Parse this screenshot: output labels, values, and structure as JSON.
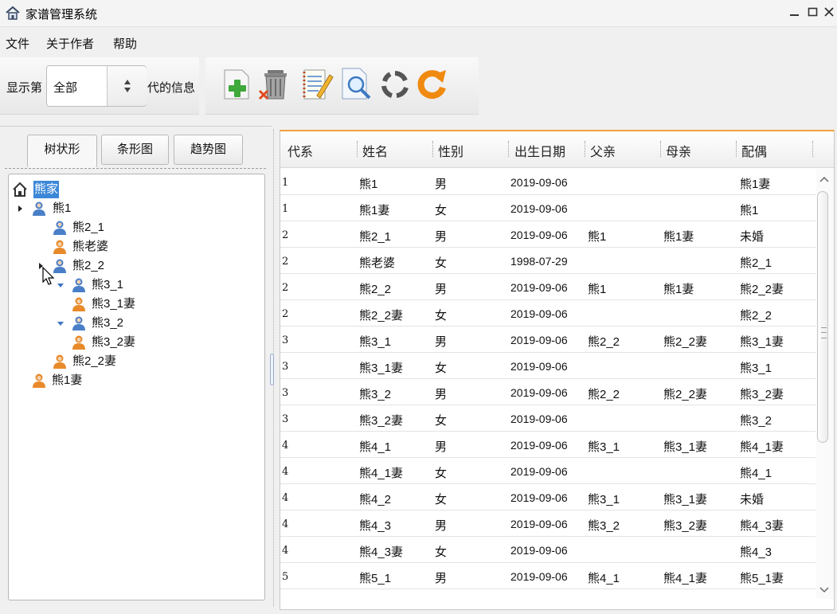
{
  "window": {
    "title": "家谱管理系统"
  },
  "menu": {
    "items": [
      "文件",
      "关于作者",
      "帮助"
    ]
  },
  "toolbar": {
    "show_prefix": "显示第",
    "show_suffix": "代的信息",
    "generation_select": {
      "value": "全部"
    },
    "tools": [
      "add-icon",
      "delete-icon",
      "edit-icon",
      "search-icon",
      "refresh-icon",
      "reload-icon"
    ]
  },
  "left_panel": {
    "tabs": [
      {
        "label": "树状形",
        "active": true
      },
      {
        "label": "条形图",
        "active": false
      },
      {
        "label": "趋势图",
        "active": false
      }
    ],
    "tree": [
      {
        "label": "熊家",
        "icon": "home-icon",
        "selected": true
      },
      {
        "label": "熊1",
        "icon": "male-person-icon",
        "toggle": "collapsed"
      },
      {
        "label": "熊2_1",
        "icon": "male-person-icon"
      },
      {
        "label": "熊老婆",
        "icon": "female-person-icon"
      },
      {
        "label": "熊2_2",
        "icon": "male-person-icon",
        "toggle": "collapsed"
      },
      {
        "label": "熊3_1",
        "icon": "male-person-icon",
        "toggle": "expanded"
      },
      {
        "label": "熊3_1妻",
        "icon": "female-person-icon"
      },
      {
        "label": "熊3_2",
        "icon": "male-person-icon",
        "toggle": "expanded"
      },
      {
        "label": "熊3_2妻",
        "icon": "female-person-icon"
      },
      {
        "label": "熊2_2妻",
        "icon": "female-person-icon"
      },
      {
        "label": "熊1妻",
        "icon": "female-person-icon"
      }
    ]
  },
  "table": {
    "columns": [
      "代系",
      "姓名",
      "性别",
      "出生日期",
      "父亲",
      "母亲",
      "配偶"
    ],
    "rows": [
      [
        "1",
        "熊1",
        "男",
        "2019-09-06",
        "",
        "",
        "熊1妻"
      ],
      [
        "1",
        "熊1妻",
        "女",
        "2019-09-06",
        "",
        "",
        "熊1"
      ],
      [
        "2",
        "熊2_1",
        "男",
        "2019-09-06",
        "熊1",
        "熊1妻",
        "未婚"
      ],
      [
        "2",
        "熊老婆",
        "女",
        "1998-07-29",
        "",
        "",
        "熊2_1"
      ],
      [
        "2",
        "熊2_2",
        "男",
        "2019-09-06",
        "熊1",
        "熊1妻",
        "熊2_2妻"
      ],
      [
        "2",
        "熊2_2妻",
        "女",
        "2019-09-06",
        "",
        "",
        "熊2_2"
      ],
      [
        "3",
        "熊3_1",
        "男",
        "2019-09-06",
        "熊2_2",
        "熊2_2妻",
        "熊3_1妻"
      ],
      [
        "3",
        "熊3_1妻",
        "女",
        "2019-09-06",
        "",
        "",
        "熊3_1"
      ],
      [
        "3",
        "熊3_2",
        "男",
        "2019-09-06",
        "熊2_2",
        "熊2_2妻",
        "熊3_2妻"
      ],
      [
        "3",
        "熊3_2妻",
        "女",
        "2019-09-06",
        "",
        "",
        "熊3_2"
      ],
      [
        "4",
        "熊4_1",
        "男",
        "2019-09-06",
        "熊3_1",
        "熊3_1妻",
        "熊4_1妻"
      ],
      [
        "4",
        "熊4_1妻",
        "女",
        "2019-09-06",
        "",
        "",
        "熊4_1"
      ],
      [
        "4",
        "熊4_2",
        "女",
        "2019-09-06",
        "熊3_1",
        "熊3_1妻",
        "未婚"
      ],
      [
        "4",
        "熊4_3",
        "男",
        "2019-09-06",
        "熊3_2",
        "熊3_2妻",
        "熊4_3妻"
      ],
      [
        "4",
        "熊4_3妻",
        "女",
        "2019-09-06",
        "",
        "",
        "熊4_3"
      ],
      [
        "5",
        "熊5_1",
        "男",
        "2019-09-06",
        "熊4_1",
        "熊4_1妻",
        "熊5_1妻"
      ]
    ]
  },
  "colors": {
    "table_accent": "#f0a23c",
    "selection": "#3b87d8",
    "male_icon": "#4a7fc8",
    "female_icon": "#e88a2a"
  }
}
